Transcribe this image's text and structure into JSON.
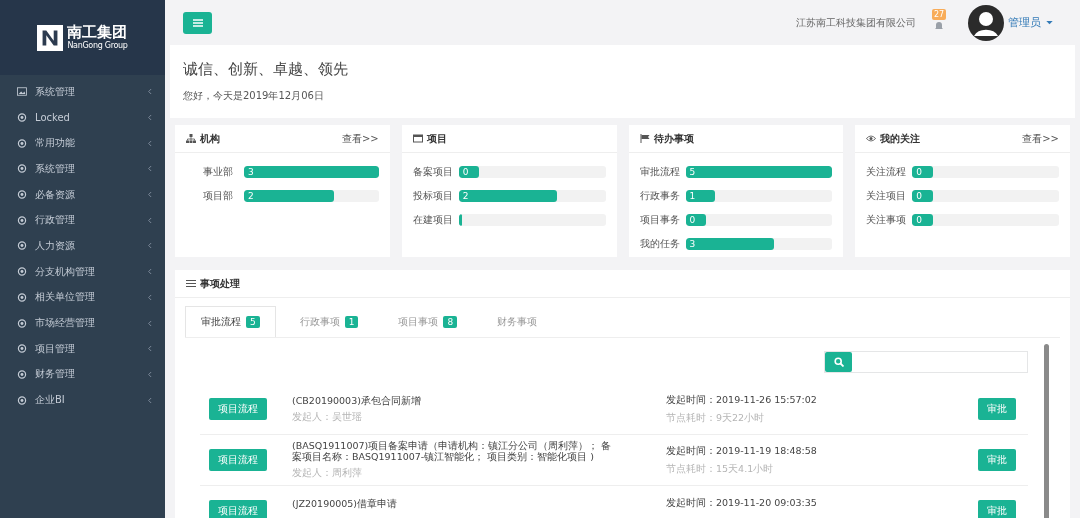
{
  "sidebar": {
    "logo": {
      "title": "南工集团",
      "subtitle": "NanGong Group"
    },
    "items": [
      {
        "label": "系统管理",
        "kind": "picture"
      },
      {
        "label": "Locked",
        "kind": "dot"
      },
      {
        "label": "常用功能",
        "kind": "dot"
      },
      {
        "label": "系统管理",
        "kind": "dot"
      },
      {
        "label": "必备资源",
        "kind": "dot"
      },
      {
        "label": "行政管理",
        "kind": "dot"
      },
      {
        "label": "人力资源",
        "kind": "dot"
      },
      {
        "label": "分支机构管理",
        "kind": "dot"
      },
      {
        "label": "相关单位管理",
        "kind": "dot"
      },
      {
        "label": "市场经营管理",
        "kind": "dot"
      },
      {
        "label": "项目管理",
        "kind": "dot"
      },
      {
        "label": "财务管理",
        "kind": "dot"
      },
      {
        "label": "企业BI",
        "kind": "dot"
      }
    ]
  },
  "header": {
    "company": "江苏南工科技集团有限公司",
    "notification_count": "27",
    "user": "管理员"
  },
  "welcome": {
    "motto": "诚信、创新、卓越、领先",
    "greeting": "您好，今天是2019年12月06日"
  },
  "cards": [
    {
      "title": "机构",
      "kind": "sitemap",
      "link": "查看>>",
      "rows": [
        {
          "label": "事业部",
          "value": "3",
          "level": 1.0
        },
        {
          "label": "项目部",
          "value": "2",
          "level": 0.67
        }
      ]
    },
    {
      "title": "项目",
      "kind": "window",
      "rows": [
        {
          "label": "备案项目",
          "value": "0",
          "level": 0.14
        },
        {
          "label": "投标项目",
          "value": "2",
          "level": 0.67
        },
        {
          "label": "在建项目",
          "level": 0.02
        }
      ]
    },
    {
      "title": "待办事项",
      "kind": "flag",
      "rows": [
        {
          "label": "审批流程",
          "value": "5",
          "level": 1.0
        },
        {
          "label": "行政事务",
          "value": "1",
          "level": 0.2
        },
        {
          "label": "项目事务",
          "value": "0",
          "level": 0.14
        },
        {
          "label": "我的任务",
          "value": "3",
          "level": 0.6
        }
      ]
    },
    {
      "title": "我的关注",
      "kind": "eye",
      "link": "查看>>",
      "rows": [
        {
          "label": "关注流程",
          "value": "0",
          "level": 0.14
        },
        {
          "label": "关注项目",
          "value": "0",
          "level": 0.14
        },
        {
          "label": "关注事项",
          "value": "0",
          "level": 0.14
        }
      ]
    }
  ],
  "tasks": {
    "title": "事项处理",
    "tabs": [
      {
        "label": "审批流程",
        "count": "5",
        "selected": true
      },
      {
        "label": "行政事项",
        "count": "1",
        "selected": false
      },
      {
        "label": "项目事项",
        "count": "8",
        "selected": false
      },
      {
        "label": "财务事项",
        "selected": false
      }
    ],
    "items": [
      {
        "type": "项目流程",
        "title": "(CB20190003)承包合同新增",
        "initiator": "发起人：吴世瑶",
        "started": "发起时间：2019-11-26 15:57:02",
        "elapsed": "节点耗时：9天22小时",
        "action": "审批"
      },
      {
        "type": "项目流程",
        "title": "(BASQ1911007)项目备案申请（申请机构：镇江分公司（周利萍）； 备案项目名称：BASQ1911007-镇江智能化； 项目类别：智能化项目 )",
        "initiator": "发起人：周利萍",
        "started": "发起时间：2019-11-19 18:48:58",
        "elapsed": "节点耗时：15天4.1小时",
        "action": "审批"
      },
      {
        "type": "项目流程",
        "title": "(JZ20190005)借章申请",
        "started": "发起时间：2019-11-20 09:03:35",
        "action": "审批"
      }
    ]
  }
}
